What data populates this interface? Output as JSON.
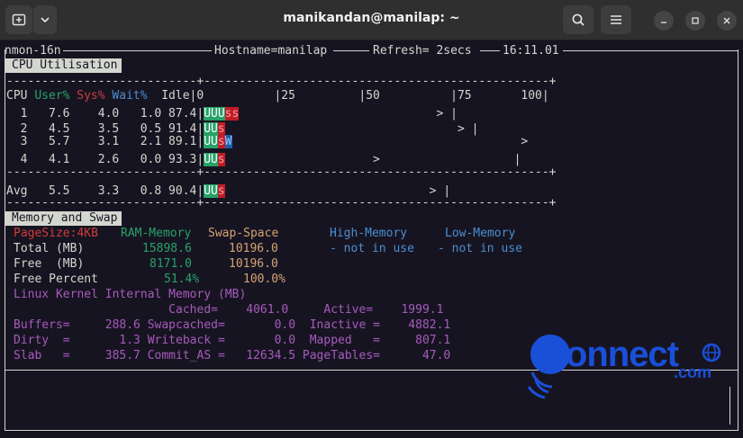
{
  "window": {
    "title": "manikandan@manilap: ~"
  },
  "nmon": {
    "version": "nmon-16n",
    "hostname_label": "Hostname=manilap",
    "refresh_label": "Refresh= 2secs",
    "time": "16:11.01"
  },
  "cpu": {
    "section_title": "CPU Utilisation",
    "dash_line": "---------------------------+-------------------------------------------------+",
    "header": {
      "cpu": "CPU",
      "user": "User%",
      "sys": "Sys%",
      "wait": "Wait%",
      "idle": "Idle",
      "scale": "|0          |25         |50          |75       100|"
    },
    "rows": [
      {
        "cpu": "  1",
        "user": " 7.6",
        "sys": "  4.0",
        "wait": "  1.0",
        "idle": " 87.4",
        "u": "UUU",
        "s": "ss",
        "w": "",
        "gap": "                            > ",
        "end": "|"
      },
      {
        "cpu": "  2",
        "user": " 4.5",
        "sys": "  3.5",
        "wait": "  0.5",
        "idle": " 91.4",
        "u": "UU",
        "s": "s",
        "w": "",
        "gap": "                                 > ",
        "end": "|"
      },
      {
        "cpu": "  3",
        "user": " 5.7",
        "sys": "  3.1",
        "wait": "  2.1",
        "idle": " 89.1",
        "u": "UU",
        "s": "s",
        "w": "W",
        "gap": "                                         ",
        "end": ">"
      },
      {
        "cpu": "  4",
        "user": " 4.1",
        "sys": "  2.6",
        "wait": "  0.0",
        "idle": " 93.3",
        "u": "UU",
        "s": "s",
        "w": "",
        "gap": "                     >                   ",
        "end": "|"
      }
    ],
    "avg": {
      "cpu": "Avg",
      "user": "  5.5",
      "sys": "  3.3",
      "wait": "  0.8",
      "idle": " 90.4",
      "u": "UU",
      "s": "s",
      "w": "",
      "gap": "                             > ",
      "end": "|"
    }
  },
  "memory": {
    "section_title": "Memory and Swap",
    "pagesize": "PageSize:4KB",
    "col_ram": "RAM-Memory",
    "col_swap": "Swap-Space",
    "col_high": "High-Memory",
    "col_low": "Low-Memory",
    "total_label": "Total (MB)",
    "total_ram": "15898.6",
    "total_swap": "10196.0",
    "high_total": "- not in use",
    "low_total": "- not in use",
    "free_label": "Free  (MB)",
    "free_ram": "8171.0",
    "free_swap": "10196.0",
    "freepct_label": "Free Percent",
    "freepct_ram": "51.4%",
    "freepct_swap": "100.0%",
    "kernel_title": "Linux Kernel Internal Memory (MB)",
    "line_cached": "                      Cached=    4061.0     Active=    1999.1",
    "line_buffers": "Buffers=     288.6 Swapcached=       0.0  Inactive =    4882.1",
    "line_dirty": "Dirty  =       1.3 Writeback =       0.0  Mapped   =     807.1",
    "line_slab": "Slab   =     385.7 Commit_AS =   12634.5 PageTables=      47.0"
  },
  "watermark": {
    "brand": "Connect",
    "tld": ".com"
  },
  "colors": {
    "user": "#26a269",
    "sys": "#c01c28",
    "wait": "#1c5fa8",
    "logo": "#1a4fd8"
  }
}
